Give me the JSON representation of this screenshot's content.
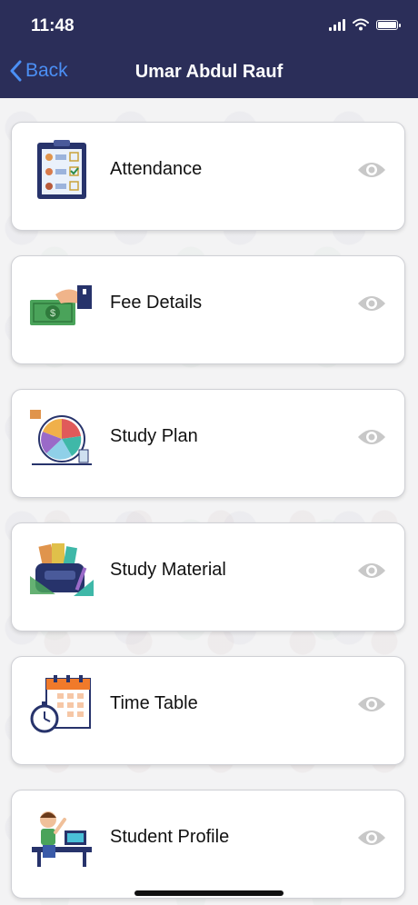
{
  "status": {
    "time": "11:48"
  },
  "nav": {
    "back_label": "Back",
    "title": "Umar Abdul Rauf"
  },
  "menu": [
    {
      "label": "Attendance",
      "icon": "attendance-clipboard-icon"
    },
    {
      "label": "Fee Details",
      "icon": "fee-money-icon"
    },
    {
      "label": "Study Plan",
      "icon": "study-plan-chart-icon"
    },
    {
      "label": "Study Material",
      "icon": "study-material-books-icon"
    },
    {
      "label": "Time Table",
      "icon": "time-table-calendar-icon"
    },
    {
      "label": "Student Profile",
      "icon": "student-profile-icon"
    }
  ],
  "colors": {
    "header": "#2b2e59",
    "back": "#4b8ff5",
    "eye": "#c8c8c8"
  }
}
